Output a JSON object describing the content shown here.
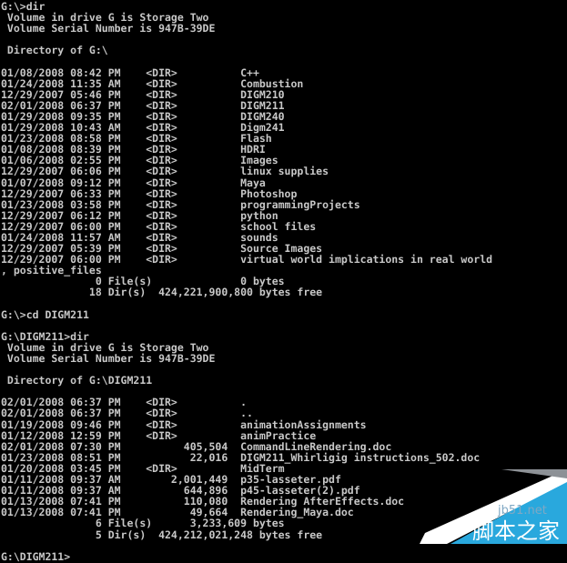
{
  "window": {
    "title": "Command Prompt",
    "background_color": "#000000",
    "text_color": "#c8c8c8"
  },
  "session": {
    "prompt_root": "G:\\>",
    "prompt_digm": "G:\\DIGM211>",
    "columns": 78
  },
  "blocks": [
    {
      "name": "first-dir-command",
      "command_line": "G:\\>dir",
      "volume_line": " Volume in drive G is Storage Two",
      "serial_line": " Volume Serial Number is 947B-39DE",
      "directory_of": " Directory of G:\\",
      "entries": [
        {
          "date": "01/08/2008",
          "time": "08:42 PM",
          "type": "<DIR>",
          "size": "",
          "name": "C++"
        },
        {
          "date": "01/24/2008",
          "time": "11:35 AM",
          "type": "<DIR>",
          "size": "",
          "name": "Combustion"
        },
        {
          "date": "12/29/2007",
          "time": "05:46 PM",
          "type": "<DIR>",
          "size": "",
          "name": "DIGM210"
        },
        {
          "date": "02/01/2008",
          "time": "06:37 PM",
          "type": "<DIR>",
          "size": "",
          "name": "DIGM211"
        },
        {
          "date": "01/29/2008",
          "time": "09:35 PM",
          "type": "<DIR>",
          "size": "",
          "name": "DIGM240"
        },
        {
          "date": "01/29/2008",
          "time": "10:43 AM",
          "type": "<DIR>",
          "size": "",
          "name": "Digm241"
        },
        {
          "date": "01/23/2008",
          "time": "08:58 PM",
          "type": "<DIR>",
          "size": "",
          "name": "Flash"
        },
        {
          "date": "01/08/2008",
          "time": "08:39 PM",
          "type": "<DIR>",
          "size": "",
          "name": "HDRI"
        },
        {
          "date": "01/06/2008",
          "time": "02:55 PM",
          "type": "<DIR>",
          "size": "",
          "name": "Images"
        },
        {
          "date": "12/29/2007",
          "time": "06:06 PM",
          "type": "<DIR>",
          "size": "",
          "name": "linux supplies"
        },
        {
          "date": "01/07/2008",
          "time": "09:12 PM",
          "type": "<DIR>",
          "size": "",
          "name": "Maya"
        },
        {
          "date": "12/29/2007",
          "time": "06:33 PM",
          "type": "<DIR>",
          "size": "",
          "name": "Photoshop"
        },
        {
          "date": "01/23/2008",
          "time": "03:58 PM",
          "type": "<DIR>",
          "size": "",
          "name": "programmingProjects"
        },
        {
          "date": "12/29/2007",
          "time": "06:12 PM",
          "type": "<DIR>",
          "size": "",
          "name": "python"
        },
        {
          "date": "12/29/2007",
          "time": "06:00 PM",
          "type": "<DIR>",
          "size": "",
          "name": "school files"
        },
        {
          "date": "01/24/2008",
          "time": "11:57 AM",
          "type": "<DIR>",
          "size": "",
          "name": "sounds"
        },
        {
          "date": "12/29/2007",
          "time": "05:39 PM",
          "type": "<DIR>",
          "size": "",
          "name": "Source Images"
        },
        {
          "date": "12/29/2007",
          "time": "06:00 PM",
          "type": "<DIR>",
          "size": "",
          "name": "virtual world implications in real world, positive_files"
        }
      ],
      "file_summary": "               0 File(s)              0 bytes",
      "dir_summary": "              18 Dir(s)  424,221,900,800 bytes free"
    },
    {
      "name": "cd-command",
      "command_line": "G:\\>cd DIGM211"
    },
    {
      "name": "second-dir-command",
      "command_line": "G:\\DIGM211>dir",
      "volume_line": " Volume in drive G is Storage Two",
      "serial_line": " Volume Serial Number is 947B-39DE",
      "directory_of": " Directory of G:\\DIGM211",
      "entries": [
        {
          "date": "02/01/2008",
          "time": "06:37 PM",
          "type": "<DIR>",
          "size": "",
          "name": "."
        },
        {
          "date": "02/01/2008",
          "time": "06:37 PM",
          "type": "<DIR>",
          "size": "",
          "name": ".."
        },
        {
          "date": "01/19/2008",
          "time": "09:46 PM",
          "type": "<DIR>",
          "size": "",
          "name": "animationAssignments"
        },
        {
          "date": "01/12/2008",
          "time": "12:59 PM",
          "type": "<DIR>",
          "size": "",
          "name": "animPractice"
        },
        {
          "date": "02/01/2008",
          "time": "07:30 PM",
          "type": "",
          "size": "405,504",
          "name": "CommandLineRendering.doc"
        },
        {
          "date": "01/23/2008",
          "time": "08:51 PM",
          "type": "",
          "size": "22,016",
          "name": "DIGM211_Whirligig instructions_502.doc"
        },
        {
          "date": "01/20/2008",
          "time": "03:45 PM",
          "type": "<DIR>",
          "size": "",
          "name": "MidTerm"
        },
        {
          "date": "01/11/2008",
          "time": "09:37 AM",
          "type": "",
          "size": "2,001,449",
          "name": "p35-lasseter.pdf"
        },
        {
          "date": "01/11/2008",
          "time": "09:37 AM",
          "type": "",
          "size": "644,896",
          "name": "p45-lasseter(2).pdf"
        },
        {
          "date": "01/13/2008",
          "time": "07:41 PM",
          "type": "",
          "size": "110,080",
          "name": "Rendering AfterEffects.doc"
        },
        {
          "date": "01/13/2008",
          "time": "07:41 PM",
          "type": "",
          "size": "49,664",
          "name": "Rendering_Maya.doc"
        }
      ],
      "file_summary": "               6 File(s)      3,233,609 bytes",
      "dir_summary": "               5 Dir(s)  424,212,021,248 bytes free"
    },
    {
      "name": "final-prompt",
      "command_line": "G:\\DIGM211>"
    }
  ],
  "watermark": {
    "site": "jb51.net",
    "site_cjk": "脚本之家",
    "accent_color": "#29a8dd",
    "band_color": "#ffffff",
    "text_color": "#7fa8c4"
  }
}
